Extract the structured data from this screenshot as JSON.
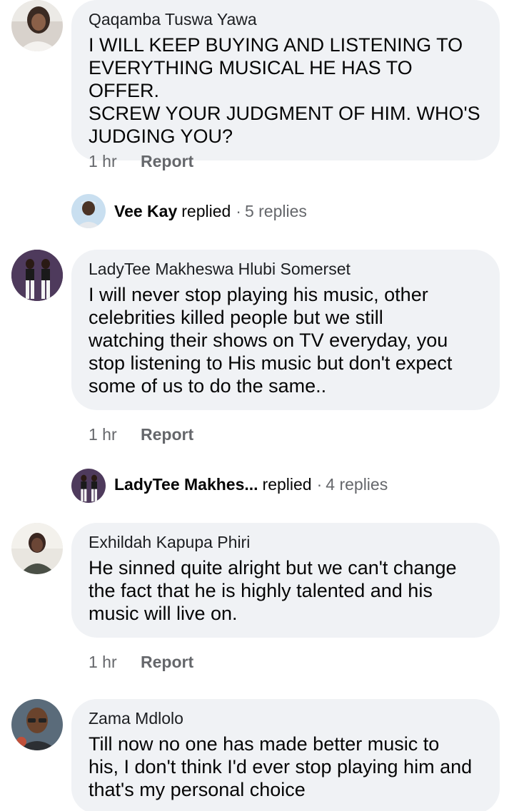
{
  "comments": [
    {
      "author": "Qaqamba Tuswa Yawa",
      "lines": [
        "I WILL KEEP BUYING AND LISTENING TO",
        "EVERYTHING MUSICAL HE HAS TO OFFER.",
        "SCREW YOUR JUDGMENT OF HIM. WHO'S",
        "JUDGING YOU?"
      ],
      "time": "1 hr",
      "report": "Report",
      "reply": {
        "name": "Vee Kay",
        "verb": "replied",
        "separator": "·",
        "count": "5 replies"
      }
    },
    {
      "author": "LadyTee Makheswa Hlubi Somerset",
      "lines": [
        "I will never stop playing his music, other",
        "celebrities killed people but we still",
        "watching their shows on TV everyday, you",
        "stop listening to His music but don't expect",
        "some of us to do the same.."
      ],
      "time": "1 hr",
      "report": "Report",
      "reply": {
        "name": "LadyTee Makhes...",
        "verb": "replied",
        "separator": "·",
        "count": "4 replies"
      }
    },
    {
      "author": "Exhildah Kapupa Phiri",
      "lines": [
        "He sinned quite alright but we can't change",
        "the fact that he is highly talented and his",
        "music will live on."
      ],
      "time": "1 hr",
      "report": "Report"
    },
    {
      "author": "Zama Mdlolo",
      "lines": [
        "Till now no one has made better music to",
        "his, I don't think I'd ever stop playing him and",
        "that's my personal choice"
      ]
    }
  ]
}
